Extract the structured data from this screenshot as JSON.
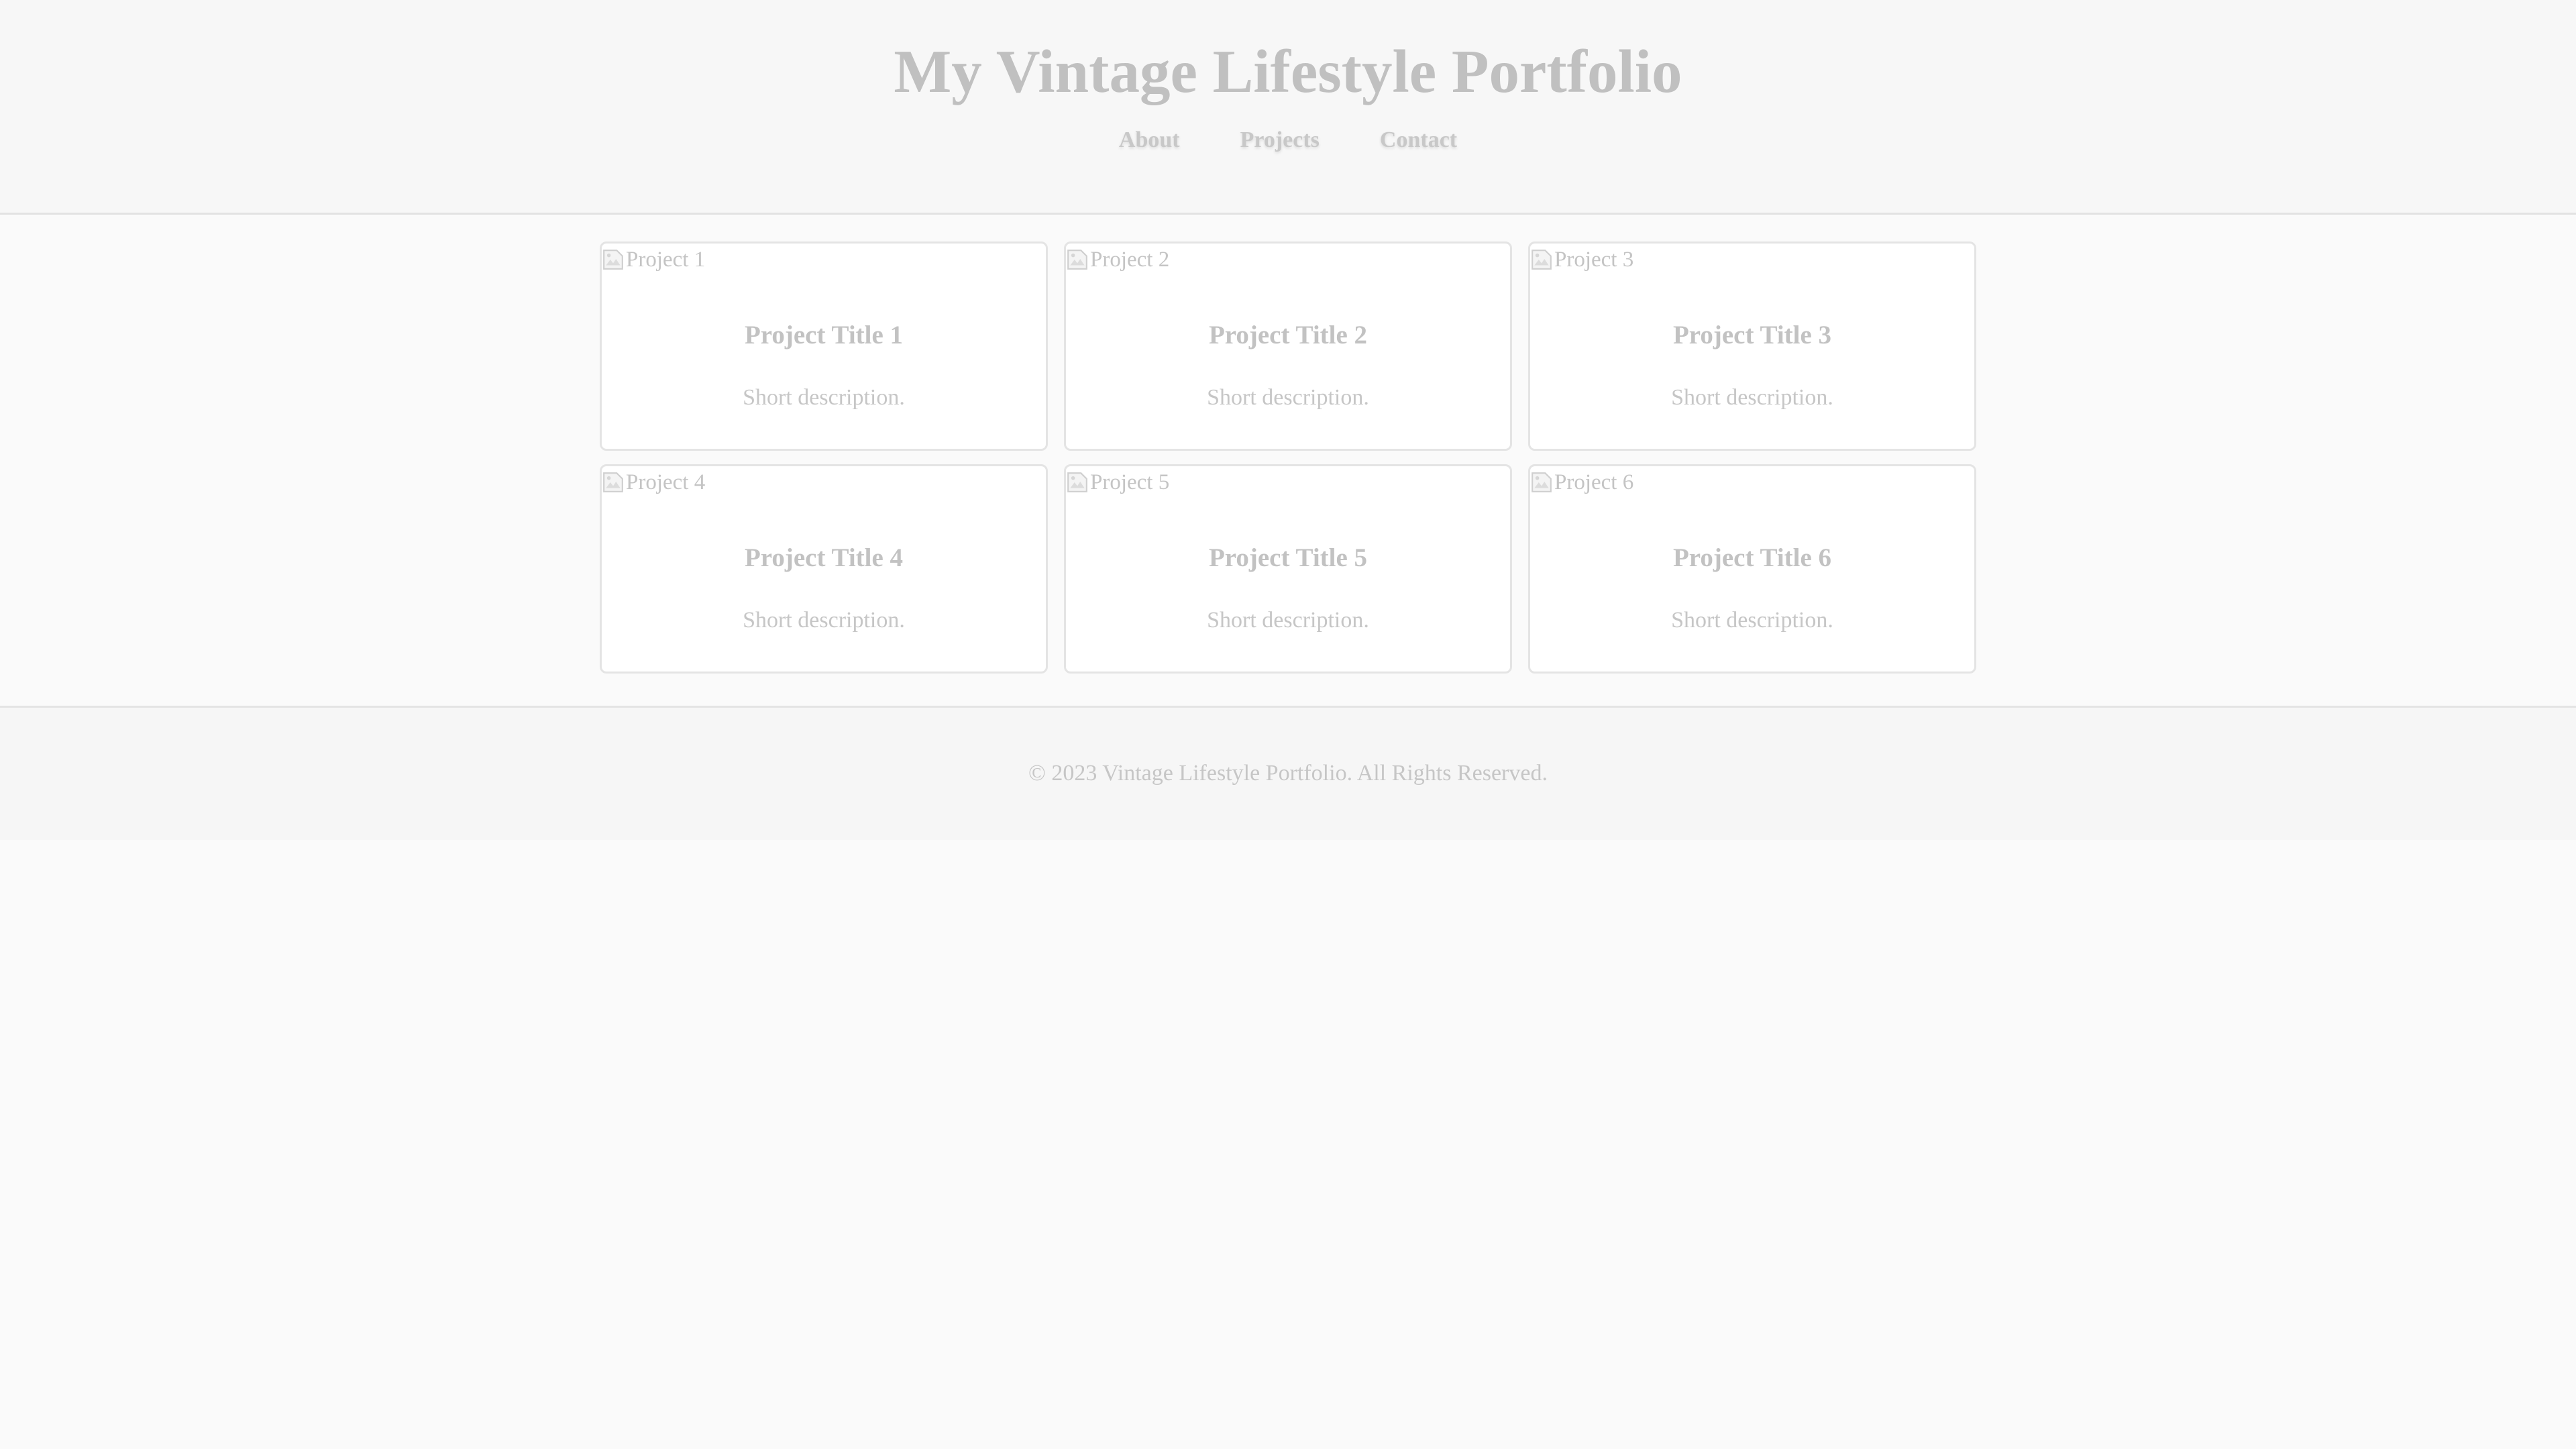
{
  "header": {
    "title": "My Vintage Lifestyle Portfolio",
    "nav": [
      "About",
      "Projects",
      "Contact"
    ]
  },
  "projects": [
    {
      "alt": "Project 1",
      "title": "Project Title 1",
      "description": "Short description."
    },
    {
      "alt": "Project 2",
      "title": "Project Title 2",
      "description": "Short description."
    },
    {
      "alt": "Project 3",
      "title": "Project Title 3",
      "description": "Short description."
    },
    {
      "alt": "Project 4",
      "title": "Project Title 4",
      "description": "Short description."
    },
    {
      "alt": "Project 5",
      "title": "Project Title 5",
      "description": "Short description."
    },
    {
      "alt": "Project 6",
      "title": "Project Title 6",
      "description": "Short description."
    }
  ],
  "footer": {
    "text": "© 2023 Vintage Lifestyle Portfolio. All Rights Reserved."
  },
  "icons": {
    "image": "broken-image-icon"
  },
  "colors": {
    "page_background": "#fafafa",
    "header_background": "#f7f7f7",
    "card_background": "#ffffff",
    "text_muted": "#c2c2c2"
  }
}
